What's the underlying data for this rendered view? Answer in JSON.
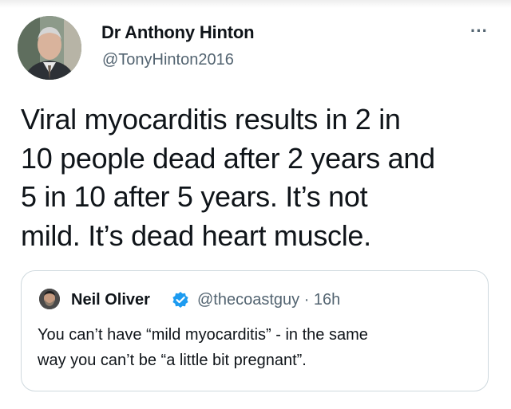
{
  "tweet": {
    "author_name": "Dr Anthony Hinton",
    "author_handle": "@TonyHinton2016",
    "more_icon": "more-horizontal-icon",
    "more_label": "···",
    "text": "Viral myocarditis results in 2 in\n10 people dead after 2 years and\n5 in 10 after 5 years. It’s not\nmild. It’s dead heart muscle."
  },
  "quote": {
    "author_name": "Neil Oliver",
    "verified_icon": "verified-badge-icon",
    "handle_time": "@thecoastguy · 16h",
    "text": "You can’t have “mild myocarditis” - in the same\nway you can’t be “a little bit pregnant”."
  },
  "colors": {
    "text": "#0f1419",
    "secondary": "#536471",
    "border": "#cfd9de",
    "verified": "#1d9bf0"
  }
}
